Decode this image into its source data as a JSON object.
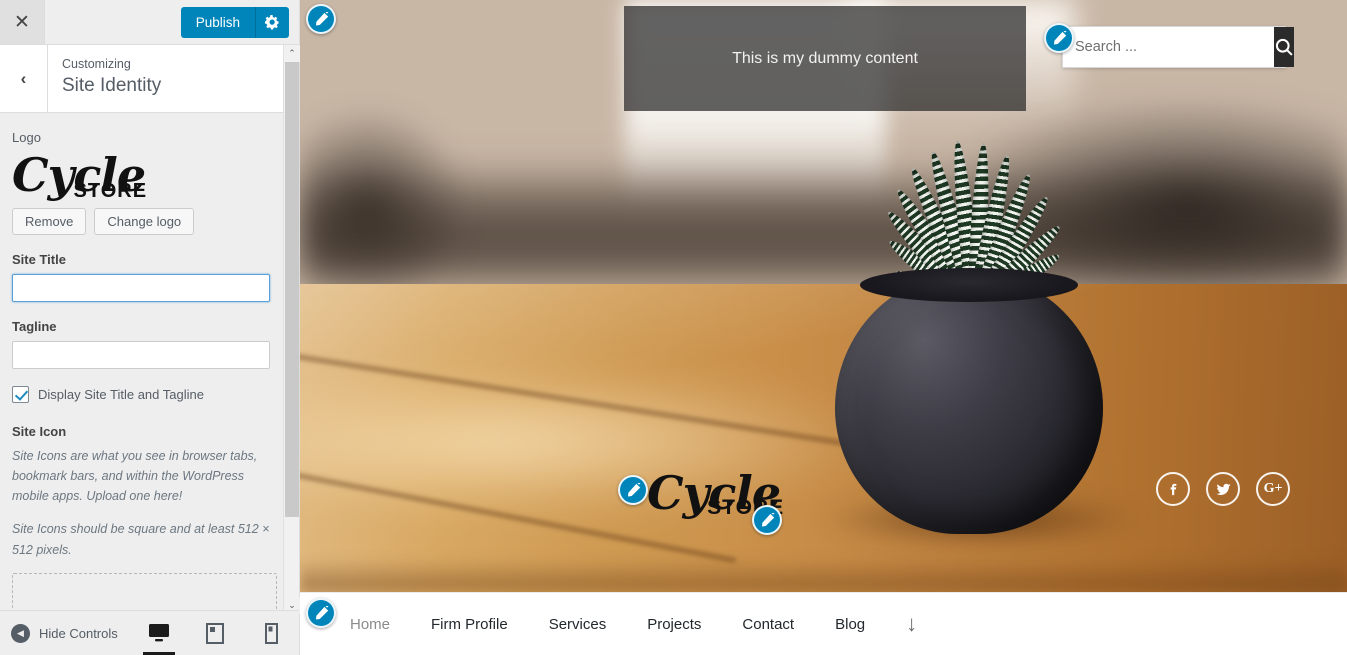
{
  "customizer": {
    "close_label": "✕",
    "publish_label": "Publish",
    "gear_label": "gear-icon",
    "back_label": "‹",
    "eyebrow": "Customizing",
    "panel_title": "Site Identity",
    "logo": {
      "label": "Logo",
      "brand_script": "Cycle",
      "brand_bold": "STORE",
      "remove_label": "Remove",
      "change_label": "Change logo"
    },
    "site_title": {
      "label": "Site Title",
      "value": "",
      "placeholder": ""
    },
    "tagline": {
      "label": "Tagline",
      "value": "",
      "placeholder": ""
    },
    "display_toggle": {
      "label": "Display Site Title and Tagline",
      "checked": true
    },
    "site_icon": {
      "label": "Site Icon",
      "desc1": "Site Icons are what you see in browser tabs, bookmark bars, and within the WordPress mobile apps. Upload one here!",
      "desc2": "Site Icons should be square and at least 512 × 512 pixels."
    },
    "footer": {
      "hide_controls_label": "Hide Controls",
      "devices": [
        {
          "name": "desktop",
          "active": true
        },
        {
          "name": "tablet",
          "active": false
        },
        {
          "name": "mobile",
          "active": false
        }
      ]
    },
    "scroll": {
      "up": "⌃",
      "down": "⌄"
    }
  },
  "preview": {
    "dummy_content": "This is my dummy content",
    "search": {
      "placeholder": "Search ...",
      "value": "",
      "button": "search-icon"
    },
    "logo": {
      "script": "Cycle",
      "bold": "STORE"
    },
    "social": [
      {
        "name": "facebook",
        "glyph": "f"
      },
      {
        "name": "twitter",
        "glyph": "t"
      },
      {
        "name": "googleplus",
        "glyph": "G+"
      }
    ],
    "nav": [
      {
        "label": "Home",
        "current": true
      },
      {
        "label": "Firm Profile",
        "current": false
      },
      {
        "label": "Services",
        "current": false
      },
      {
        "label": "Projects",
        "current": false
      },
      {
        "label": "Contact",
        "current": false
      },
      {
        "label": "Blog",
        "current": false
      }
    ],
    "nav_more": "↓"
  },
  "colors": {
    "wp_blue": "#0085ba",
    "sidebar_bg": "#eeeeee",
    "search_btn": "#2b2b2b"
  }
}
